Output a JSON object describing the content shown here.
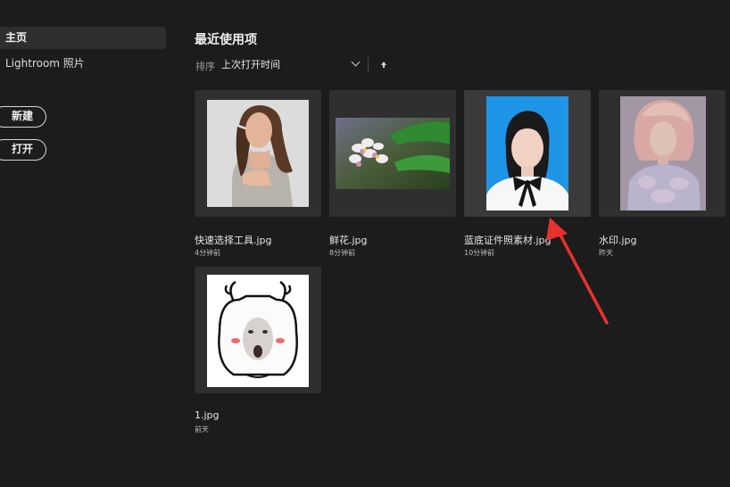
{
  "sidebar": {
    "items": [
      {
        "label": "主页",
        "active": true
      },
      {
        "label": "Lightroom 照片",
        "active": false
      }
    ],
    "new_label": "新建",
    "open_label": "打开"
  },
  "main": {
    "title": "最近使用项",
    "sort": {
      "label": "排序",
      "value": "上次打开时间"
    },
    "files": [
      {
        "name": "快速选择工具.jpg",
        "time": "4分钟前"
      },
      {
        "name": "鲜花.jpg",
        "time": "8分钟前"
      },
      {
        "name": "蓝底证件照素材.jpg",
        "time": "10分钟前"
      },
      {
        "name": "水印.jpg",
        "time": "昨天"
      },
      {
        "name": "1.jpg",
        "time": "前天"
      }
    ]
  },
  "colors": {
    "background": "#1c1c1c",
    "card": "#2f2f2f",
    "annotation_arrow": "#e8312f"
  }
}
